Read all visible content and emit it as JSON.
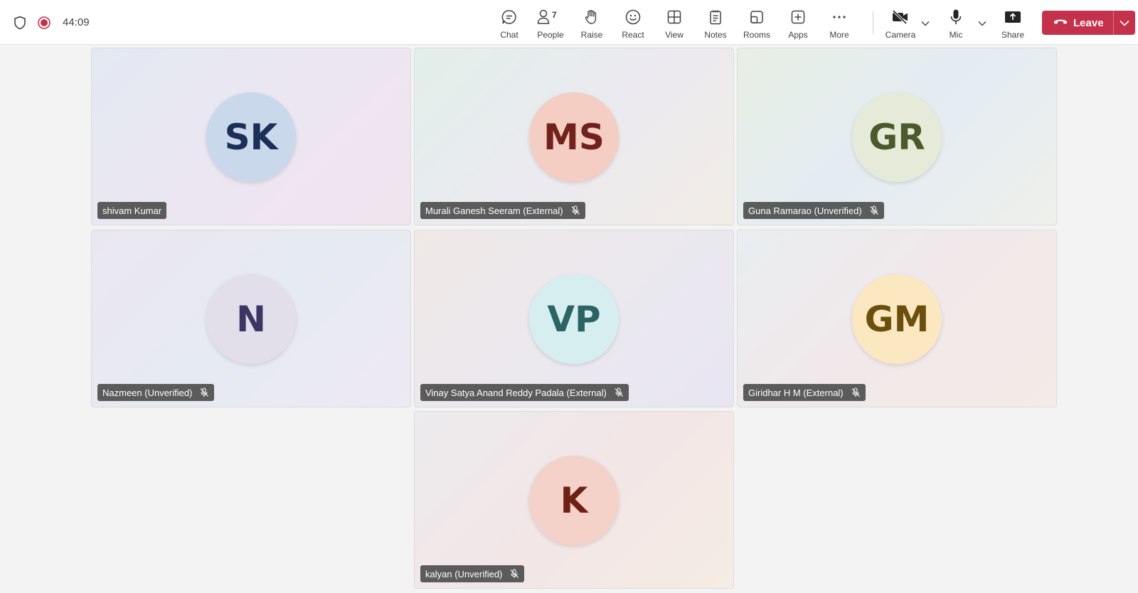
{
  "status": {
    "timer": "44:09"
  },
  "toolbar": {
    "chat": "Chat",
    "people": "People",
    "people_count": "7",
    "raise": "Raise",
    "react": "React",
    "view": "View",
    "notes": "Notes",
    "rooms": "Rooms",
    "apps": "Apps",
    "more": "More",
    "camera": "Camera",
    "mic": "Mic",
    "share": "Share",
    "leave": "Leave"
  },
  "colors": {
    "leave": "#c4314b"
  },
  "participants": [
    {
      "initials": "SK",
      "name": "shivam Kumar",
      "muted": false,
      "avatar_bg": "#c9d8ea",
      "avatar_fg": "#1b2f57"
    },
    {
      "initials": "MS",
      "name": "Murali Ganesh Seeram (External)",
      "muted": true,
      "avatar_bg": "#f4cdc3",
      "avatar_fg": "#72221a"
    },
    {
      "initials": "GR",
      "name": "Guna Ramarao (Unverified)",
      "muted": true,
      "avatar_bg": "#e5ebd8",
      "avatar_fg": "#4a5a2b"
    },
    {
      "initials": "N",
      "name": "Nazmeen (Unverified)",
      "muted": true,
      "avatar_bg": "#e3dfea",
      "avatar_fg": "#3b3663"
    },
    {
      "initials": "VP",
      "name": "Vinay Satya Anand Reddy Padala (External)",
      "muted": true,
      "avatar_bg": "#d7eef0",
      "avatar_fg": "#2c6466"
    },
    {
      "initials": "GM",
      "name": "Giridhar H M (External)",
      "muted": true,
      "avatar_bg": "#fbe8c1",
      "avatar_fg": "#6c4f0d"
    },
    {
      "initials": "K",
      "name": "kalyan (Unverified)",
      "muted": true,
      "avatar_bg": "#f4d1c9",
      "avatar_fg": "#6e2014"
    }
  ]
}
